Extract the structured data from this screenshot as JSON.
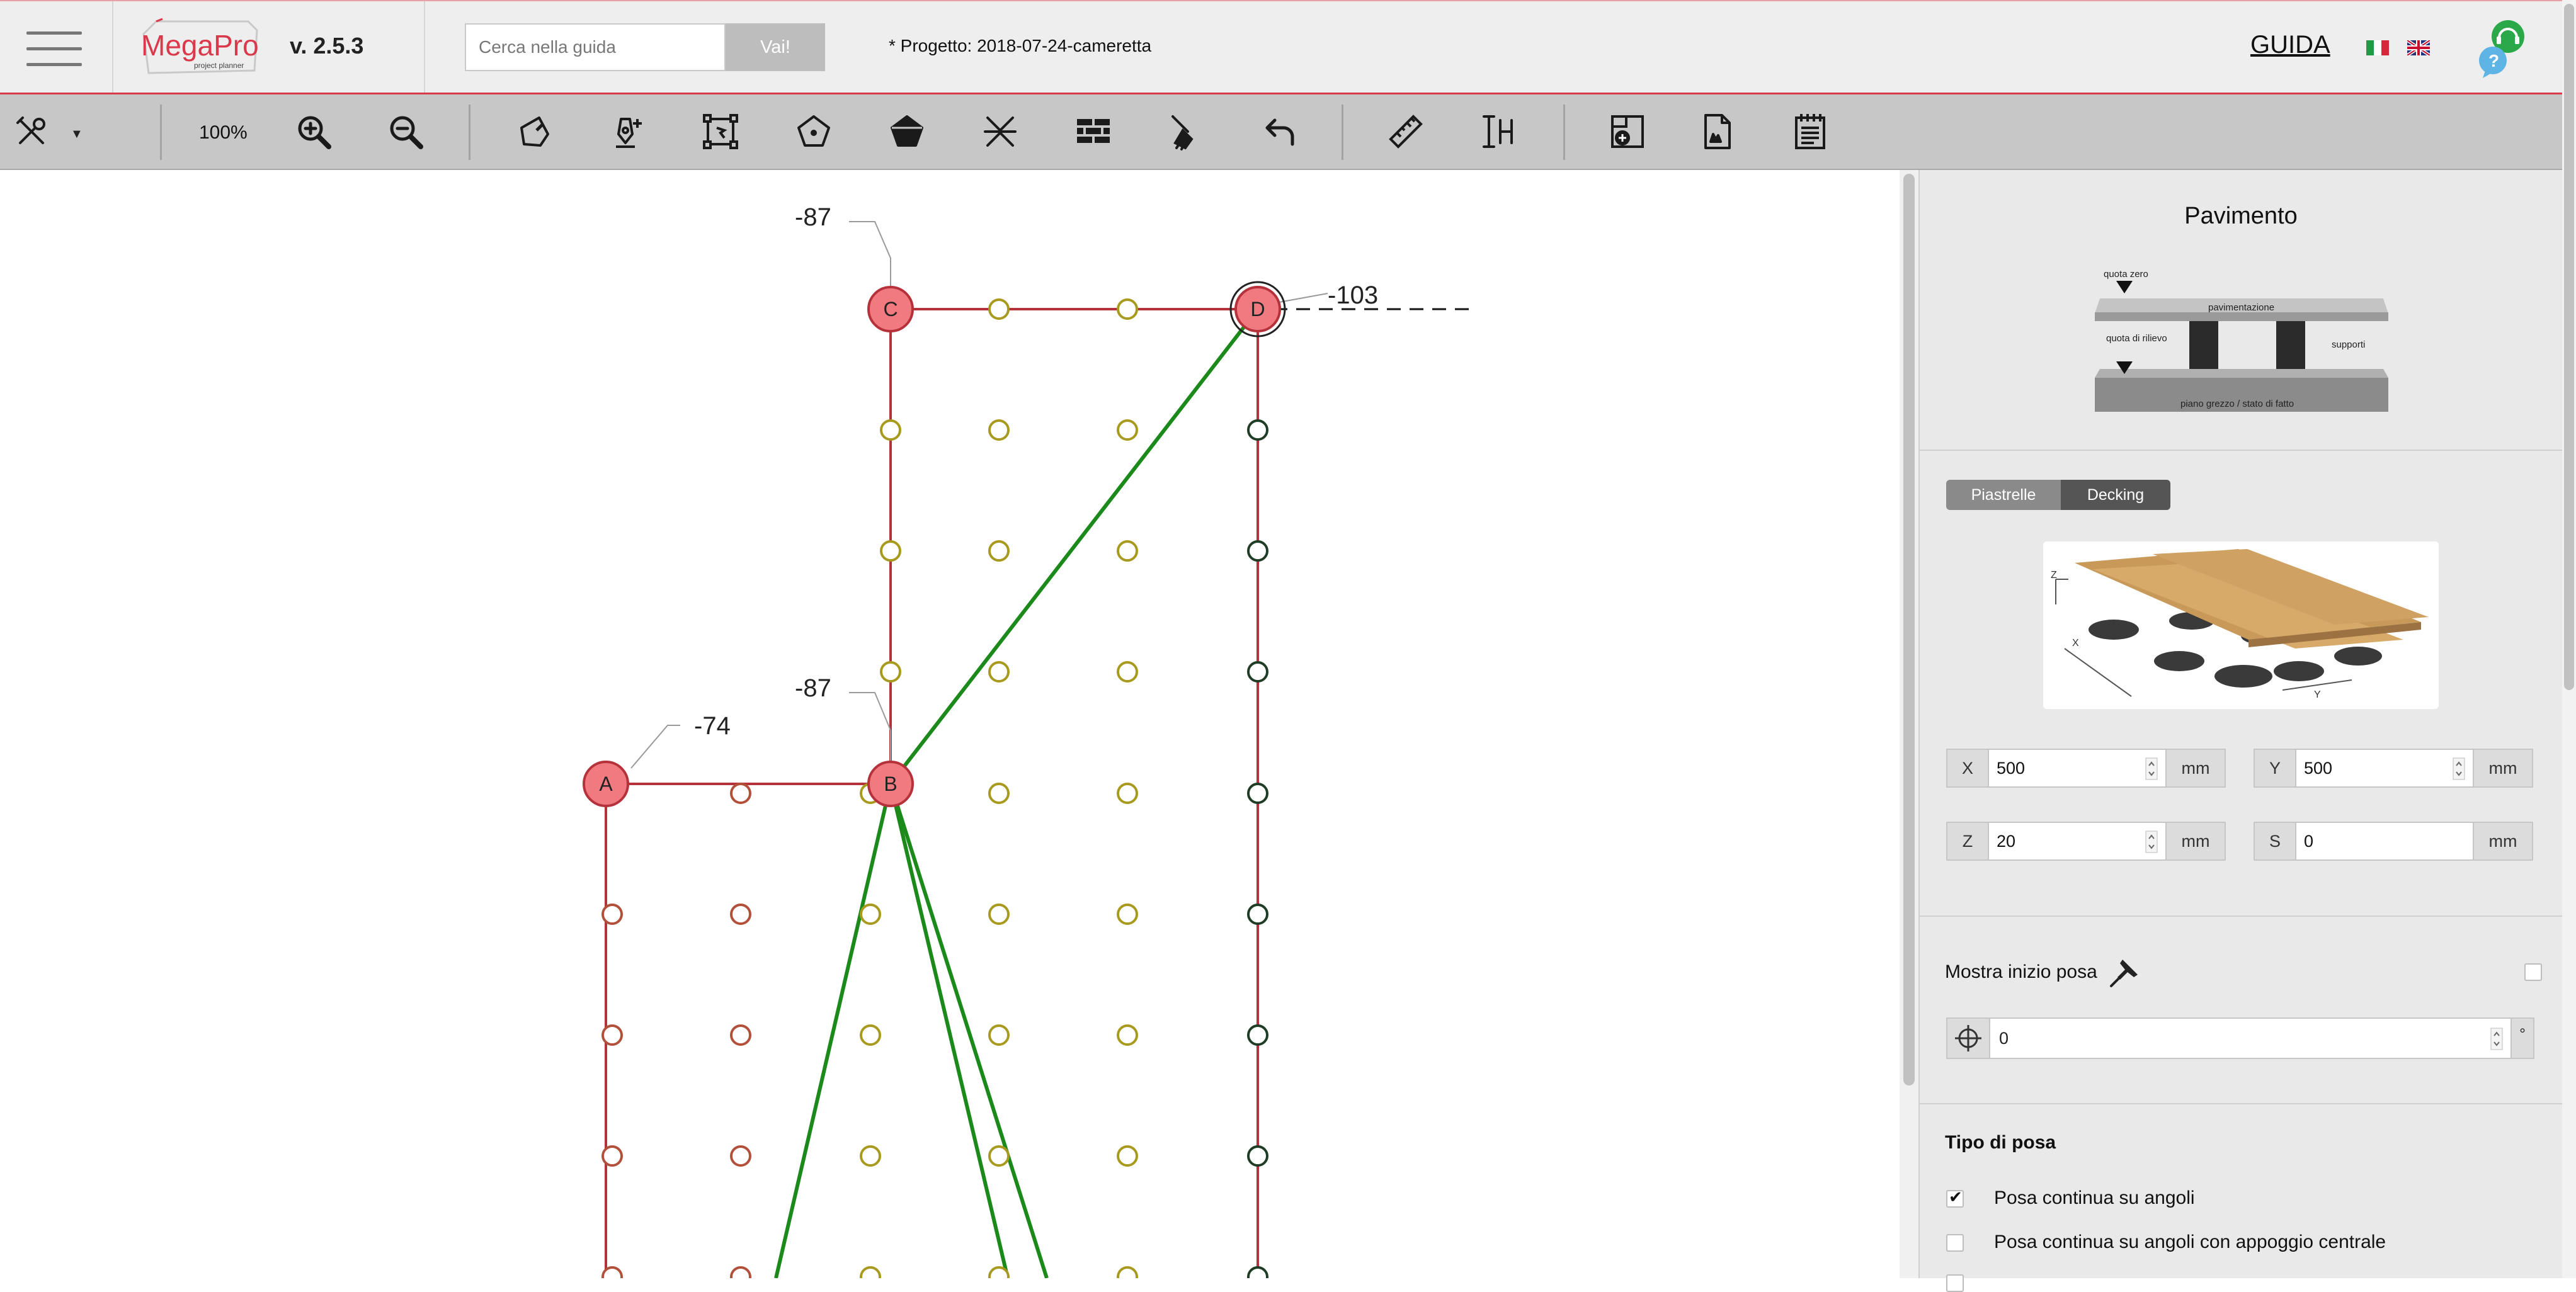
{
  "header": {
    "logo_text": "MegaPro",
    "logo_subtitle": "project planner",
    "version": "v. 2.5.3",
    "search_placeholder": "Cerca nella guida",
    "search_button": "Vai!",
    "project_label": "* Progetto: 2018-07-24-cameretta",
    "guide_link": "GUIDA"
  },
  "toolbar": {
    "zoom_level": "100%",
    "colors": {
      "background": "#c7c7c7",
      "icon": "#1a1a1a"
    }
  },
  "canvas": {
    "colors": {
      "outline": "#b5323a",
      "node_fill": "#f07a80",
      "link": "#1b8a1b",
      "support_ochre": "#a89a1f",
      "support_brick": "#b2503a",
      "support_dark": "#1f3d24"
    },
    "corners": [
      {
        "id": "C",
        "elevation": "-87"
      },
      {
        "id": "D",
        "elevation": "-103"
      },
      {
        "id": "B",
        "elevation": "-87"
      },
      {
        "id": "A",
        "elevation": "-74"
      }
    ]
  },
  "panel": {
    "title": "Pavimento",
    "diagram": {
      "quota_zero": "quota zero",
      "pavimentazione": "pavimentazione",
      "quota_rilievo": "quota di rilievo",
      "supporti": "supporti",
      "piano": "piano grezzo / stato di fatto"
    },
    "tabs": [
      {
        "label": "Piastrelle",
        "active": false
      },
      {
        "label": "Decking",
        "active": true
      }
    ],
    "deck_axes": {
      "x": "X",
      "y": "Y",
      "z": "Z"
    },
    "fields": {
      "x": {
        "label": "X",
        "value": "500",
        "unit": "mm"
      },
      "y": {
        "label": "Y",
        "value": "500",
        "unit": "mm"
      },
      "z": {
        "label": "Z",
        "value": "20",
        "unit": "mm"
      },
      "s": {
        "label": "S",
        "value": "0",
        "unit": "mm"
      }
    },
    "show_start": {
      "label": "Mostra inizio posa",
      "checked": false
    },
    "rotation": {
      "value": "0",
      "unit": "°"
    },
    "laying_type": {
      "title": "Tipo di posa",
      "options": [
        {
          "label": "Posa continua su angoli",
          "checked": true
        },
        {
          "label": "Posa continua su angoli con appoggio centrale",
          "checked": false
        }
      ]
    }
  }
}
